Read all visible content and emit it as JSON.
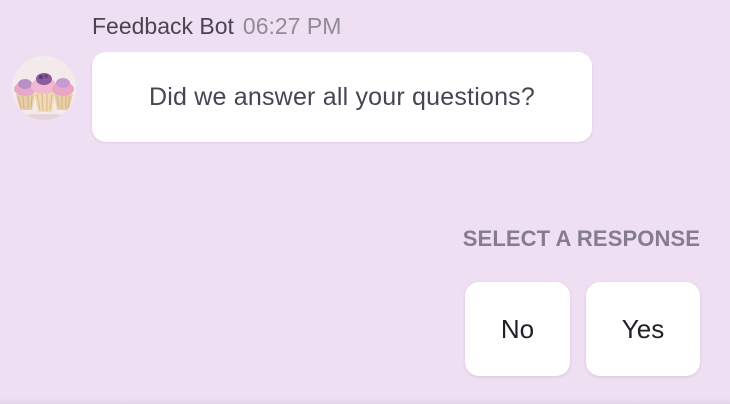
{
  "message": {
    "sender": "Feedback Bot",
    "time": "06:27 PM",
    "text": "Did we answer all your questions?",
    "avatar_icon": "cupcakes-avatar"
  },
  "responses": {
    "label": "SELECT A RESPONSE",
    "options": [
      "No",
      "Yes"
    ]
  },
  "colors": {
    "background": "#efdff2",
    "bubble": "#ffffff",
    "text": "#4a4452",
    "muted": "#8f8a96"
  }
}
